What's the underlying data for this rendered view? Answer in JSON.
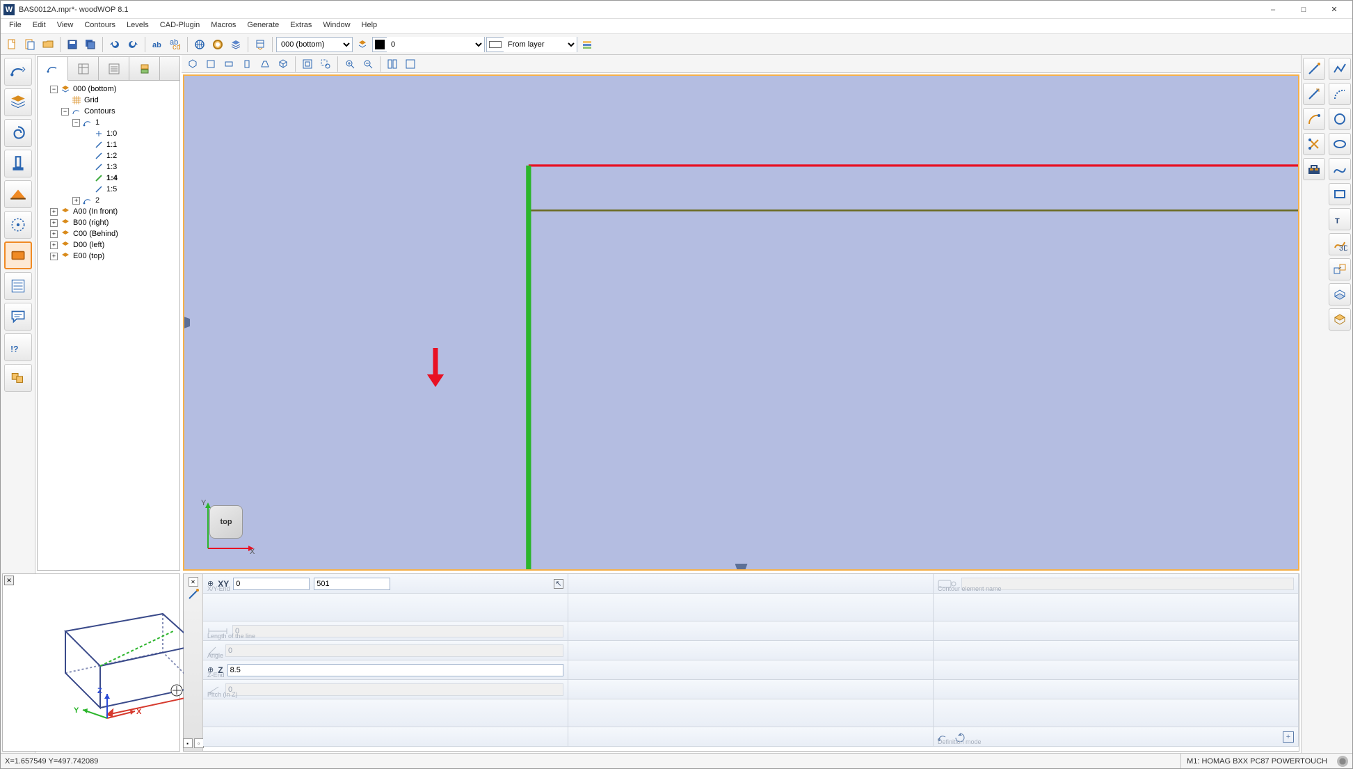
{
  "window": {
    "title": "BAS0012A.mpr*- woodWOP 8.1",
    "app_icon_text": "W"
  },
  "menu": [
    "File",
    "Edit",
    "View",
    "Contours",
    "Levels",
    "CAD-Plugin",
    "Macros",
    "Generate",
    "Extras",
    "Window",
    "Help"
  ],
  "combo": {
    "level": "000  (bottom)",
    "layer_val": "0",
    "from_layer": "From layer"
  },
  "tree": {
    "root": "000 (bottom)",
    "grid": "Grid",
    "contours": "Contours",
    "c1": "1",
    "c1_items": [
      "1:0",
      "1:1",
      "1:2",
      "1:3",
      "1:4",
      "1:5"
    ],
    "c2": "2",
    "faces": [
      {
        "label": "A00 (In front)"
      },
      {
        "label": "B00 (right)"
      },
      {
        "label": "C00 (Behind)"
      },
      {
        "label": "D00 (left)"
      },
      {
        "label": "E00 (top)"
      }
    ]
  },
  "axis_widget": {
    "label": "top",
    "x": "X",
    "y": "Y"
  },
  "props": {
    "xy_label": "XY",
    "xy_sublabel": "X/Y-End",
    "xy_x": "0",
    "xy_y": "501",
    "len_label": "Length of the line",
    "len_val": "0",
    "angle_label": "Angle",
    "angle_val": "0",
    "z_label": "Z",
    "z_sublabel": "Z-End",
    "z_val": "8.5",
    "pitch_label": "Pitch (in Z)",
    "pitch_val": "0",
    "elem_name_label": "Contour element name",
    "def_mode_label": "Definition mode"
  },
  "preview_axes": {
    "x": "X",
    "y": "Y",
    "z": "Z"
  },
  "status": {
    "coords": "X=1.657549 Y=497.742089",
    "machine": "M1: HOMAG BXX PC87 POWERTOUCH"
  }
}
